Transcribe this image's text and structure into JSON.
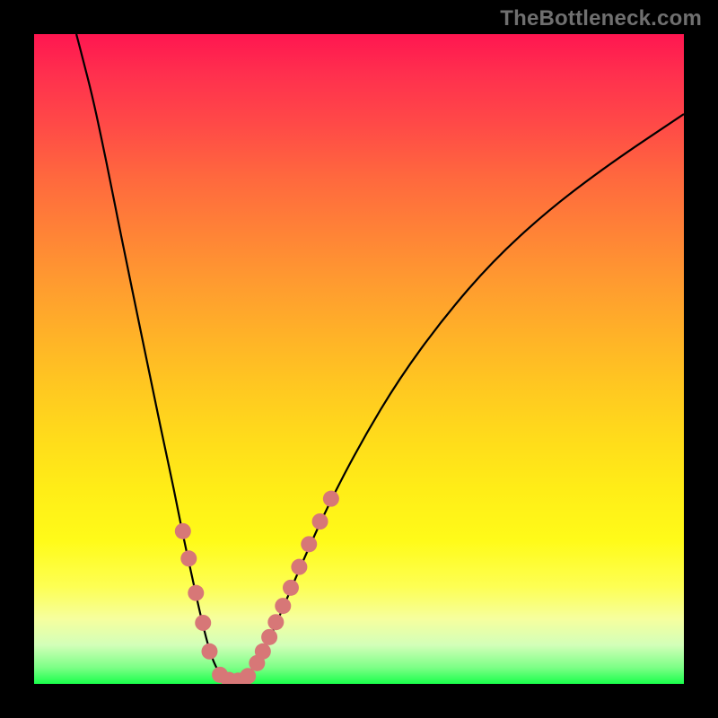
{
  "watermark": "TheBottleneck.com",
  "chart_data": {
    "type": "line",
    "title": "",
    "xlabel": "",
    "ylabel": "",
    "x_range": [
      0,
      1
    ],
    "y_range": [
      0,
      1
    ],
    "curve_points": [
      {
        "x": 0.065,
        "y": 1.0
      },
      {
        "x": 0.075,
        "y": 0.962
      },
      {
        "x": 0.09,
        "y": 0.903
      },
      {
        "x": 0.104,
        "y": 0.838
      },
      {
        "x": 0.118,
        "y": 0.77
      },
      {
        "x": 0.131,
        "y": 0.704
      },
      {
        "x": 0.145,
        "y": 0.636
      },
      {
        "x": 0.159,
        "y": 0.567
      },
      {
        "x": 0.173,
        "y": 0.5
      },
      {
        "x": 0.187,
        "y": 0.432
      },
      {
        "x": 0.201,
        "y": 0.365
      },
      {
        "x": 0.215,
        "y": 0.3
      },
      {
        "x": 0.228,
        "y": 0.234
      },
      {
        "x": 0.242,
        "y": 0.17
      },
      {
        "x": 0.256,
        "y": 0.106
      },
      {
        "x": 0.27,
        "y": 0.05
      },
      {
        "x": 0.283,
        "y": 0.018
      },
      {
        "x": 0.3,
        "y": 0.005
      },
      {
        "x": 0.318,
        "y": 0.005
      },
      {
        "x": 0.335,
        "y": 0.02
      },
      {
        "x": 0.356,
        "y": 0.055
      },
      {
        "x": 0.381,
        "y": 0.112
      },
      {
        "x": 0.414,
        "y": 0.19
      },
      {
        "x": 0.455,
        "y": 0.28
      },
      {
        "x": 0.505,
        "y": 0.375
      },
      {
        "x": 0.562,
        "y": 0.47
      },
      {
        "x": 0.63,
        "y": 0.563
      },
      {
        "x": 0.705,
        "y": 0.65
      },
      {
        "x": 0.79,
        "y": 0.728
      },
      {
        "x": 0.885,
        "y": 0.8
      },
      {
        "x": 1.0,
        "y": 0.877
      }
    ],
    "dots_left": [
      {
        "x": 0.229,
        "y": 0.235
      },
      {
        "x": 0.238,
        "y": 0.193
      },
      {
        "x": 0.249,
        "y": 0.14
      },
      {
        "x": 0.26,
        "y": 0.094
      },
      {
        "x": 0.27,
        "y": 0.05
      }
    ],
    "dots_bottom": [
      {
        "x": 0.286,
        "y": 0.014
      },
      {
        "x": 0.3,
        "y": 0.006
      },
      {
        "x": 0.314,
        "y": 0.005
      },
      {
        "x": 0.329,
        "y": 0.012
      }
    ],
    "dots_right": [
      {
        "x": 0.343,
        "y": 0.032
      },
      {
        "x": 0.352,
        "y": 0.05
      },
      {
        "x": 0.362,
        "y": 0.072
      },
      {
        "x": 0.372,
        "y": 0.095
      },
      {
        "x": 0.383,
        "y": 0.12
      },
      {
        "x": 0.395,
        "y": 0.148
      },
      {
        "x": 0.408,
        "y": 0.18
      },
      {
        "x": 0.423,
        "y": 0.215
      },
      {
        "x": 0.44,
        "y": 0.25
      },
      {
        "x": 0.457,
        "y": 0.285
      }
    ],
    "gradient_colors": {
      "top": "#ff1650",
      "mid1": "#ff8137",
      "mid2": "#ffeb17",
      "bottom": "#1aff4b"
    },
    "dot_color": "#d77777",
    "curve_color": "#000000"
  }
}
